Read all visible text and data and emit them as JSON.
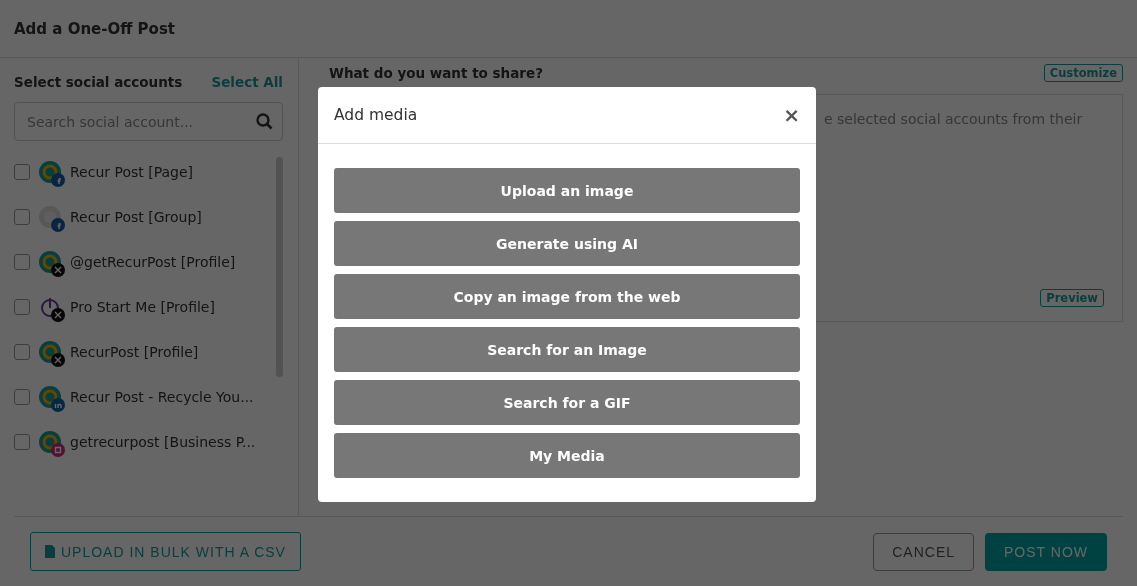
{
  "window": {
    "title": "Add a One-Off Post"
  },
  "accounts_panel": {
    "title": "Select social accounts",
    "select_all": "Select All",
    "search": {
      "placeholder": "Search social account..."
    },
    "accounts": [
      {
        "name": "Recur Post [Page]",
        "checked": false,
        "avatar": {
          "kind": "logo"
        },
        "badge": {
          "kind": "facebook"
        }
      },
      {
        "name": "Recur Post [Group]",
        "checked": false,
        "avatar": {
          "kind": "grey"
        },
        "badge": {
          "kind": "facebook"
        }
      },
      {
        "name": "@getRecurPost [Profile]",
        "checked": false,
        "avatar": {
          "kind": "logo"
        },
        "badge": {
          "kind": "x"
        }
      },
      {
        "name": "Pro Start Me [Profile]",
        "checked": false,
        "avatar": {
          "kind": "timer"
        },
        "badge": {
          "kind": "x"
        }
      },
      {
        "name": "RecurPost [Profile]",
        "checked": false,
        "avatar": {
          "kind": "logo"
        },
        "badge": {
          "kind": "x"
        }
      },
      {
        "name": "Recur Post - Recycle You...",
        "checked": false,
        "avatar": {
          "kind": "logo"
        },
        "badge": {
          "kind": "linkedin"
        }
      },
      {
        "name": "getrecurpost [Business P...",
        "checked": false,
        "avatar": {
          "kind": "logo"
        },
        "badge": {
          "kind": "instagram"
        }
      }
    ]
  },
  "composer": {
    "title": "What do you want to share?",
    "customize": "Customize",
    "text": "e selected social accounts from their",
    "preview": "Preview"
  },
  "footer": {
    "bulk_upload": "UPLOAD IN BULK WITH A CSV",
    "cancel": "CANCEL",
    "post_now": "POST NOW"
  },
  "dialog": {
    "title": "Add media",
    "close": "×",
    "options": [
      "Upload an image",
      "Generate using AI",
      "Copy an image from the web",
      "Search for an Image",
      "Search for a GIF",
      "My Media"
    ]
  }
}
